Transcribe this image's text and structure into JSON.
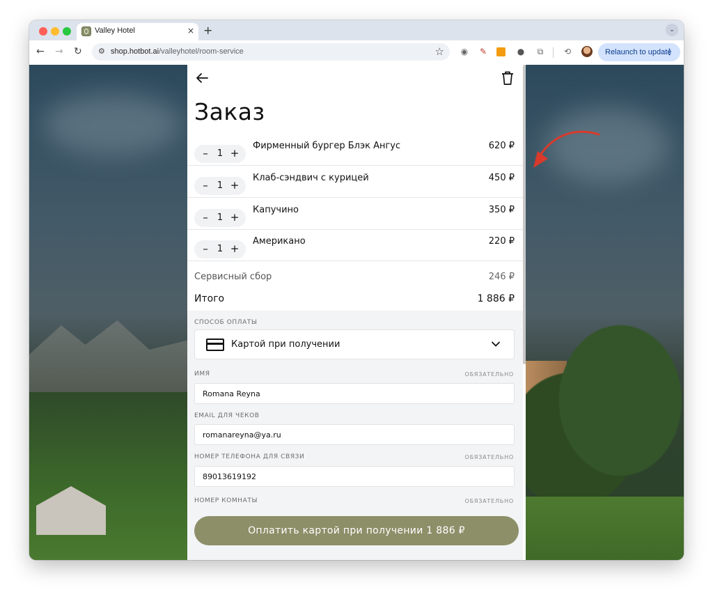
{
  "browser": {
    "tab_title": "Valley Hotel",
    "tab_close": "×",
    "new_tab": "+",
    "url_host": "shop.hotbot.ai",
    "url_path": "/valleyhotel/room-service",
    "relaunch_label": "Relaunch to update"
  },
  "order": {
    "title": "Заказ",
    "items": [
      {
        "qty": "1",
        "name": "Фирменный бургер Блэк Ангус",
        "price": "620 ₽"
      },
      {
        "qty": "1",
        "name": "Клаб-сэндвич с курицей",
        "price": "450 ₽"
      },
      {
        "qty": "1",
        "name": "Капучино",
        "price": "350 ₽"
      },
      {
        "qty": "1",
        "name": "Американо",
        "price": "220 ₽"
      }
    ],
    "service_fee_label": "Сервисный сбор",
    "service_fee_value": "246 ₽",
    "total_label": "Итого",
    "total_value": "1 886 ₽"
  },
  "form": {
    "payment_label": "СПОСОБ ОПЛАТЫ",
    "payment_value": "Картой при получении",
    "name_label": "ИМЯ",
    "required": "ОБЯЗАТЕЛЬНО",
    "name_value": "Romana Reyna",
    "email_label": "EMAIL ДЛЯ ЧЕКОВ",
    "email_value": "romanareyna@ya.ru",
    "phone_label": "НОМЕР ТЕЛЕФОНА ДЛЯ СВЯЗИ",
    "phone_value": "89013619192",
    "room_label": "НОМЕР КОМНАТЫ"
  },
  "pay_button_label": "Оплатить картой при получении 1 886 ₽",
  "colors": {
    "accent": "#8c8f68",
    "annotation_arrow": "#d93a2b"
  }
}
